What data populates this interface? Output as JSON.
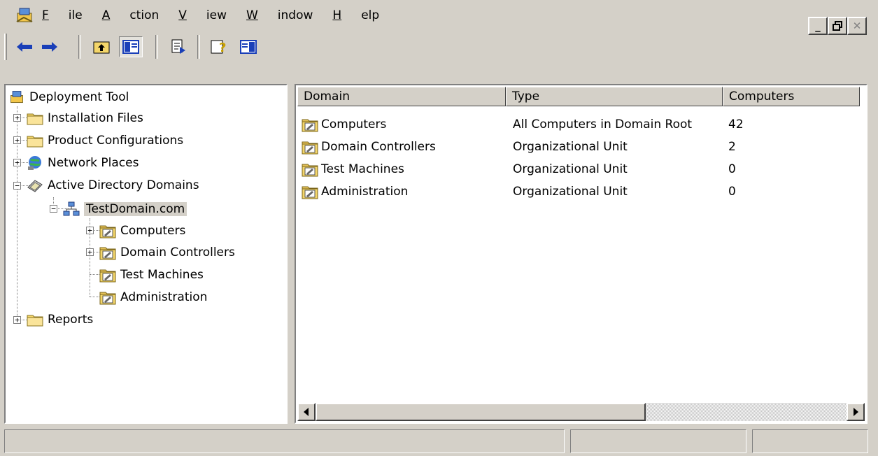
{
  "menubar": {
    "app_icon": "mmc-console-icon",
    "items": [
      "File",
      "Action",
      "View",
      "Window",
      "Help"
    ],
    "window_controls": [
      "minimize-icon",
      "restore-icon",
      "close-icon"
    ]
  },
  "toolbar": {
    "buttons": [
      "back-arrow-icon",
      "forward-arrow-icon",
      "up-one-level-icon",
      "show-hide-tree-icon",
      "export-list-icon",
      "help-icon",
      "show-hide-action-pane-icon"
    ]
  },
  "tree": {
    "root": "Deployment Tool",
    "items": [
      {
        "label": "Installation Files",
        "icon": "folder-icon"
      },
      {
        "label": "Product Configurations",
        "icon": "folder-icon"
      },
      {
        "label": "Network Places",
        "icon": "network-places-icon"
      },
      {
        "label": "Active Directory Domains",
        "icon": "active-directory-icon"
      },
      {
        "label": "TestDomain.com",
        "icon": "domain-icon"
      },
      {
        "label": "Computers",
        "icon": "ou-folder-icon"
      },
      {
        "label": "Domain Controllers",
        "icon": "ou-folder-icon"
      },
      {
        "label": "Test Machines",
        "icon": "ou-folder-icon"
      },
      {
        "label": "Administration",
        "icon": "ou-folder-icon"
      },
      {
        "label": "Reports",
        "icon": "folder-icon"
      }
    ]
  },
  "list": {
    "columns": [
      "Domain",
      "Type",
      "Computers"
    ],
    "rows": [
      {
        "domain": "Computers",
        "type": "All Computers in Domain Root",
        "computers": "42"
      },
      {
        "domain": "Domain Controllers",
        "type": "Organizational Unit",
        "computers": "2"
      },
      {
        "domain": "Test Machines",
        "type": "Organizational Unit",
        "computers": "0"
      },
      {
        "domain": "Administration",
        "type": "Organizational Unit",
        "computers": "0"
      }
    ]
  },
  "colors": {
    "face": "#d4d0c8",
    "shadow": "#808080",
    "folder": "#f5d76e"
  }
}
